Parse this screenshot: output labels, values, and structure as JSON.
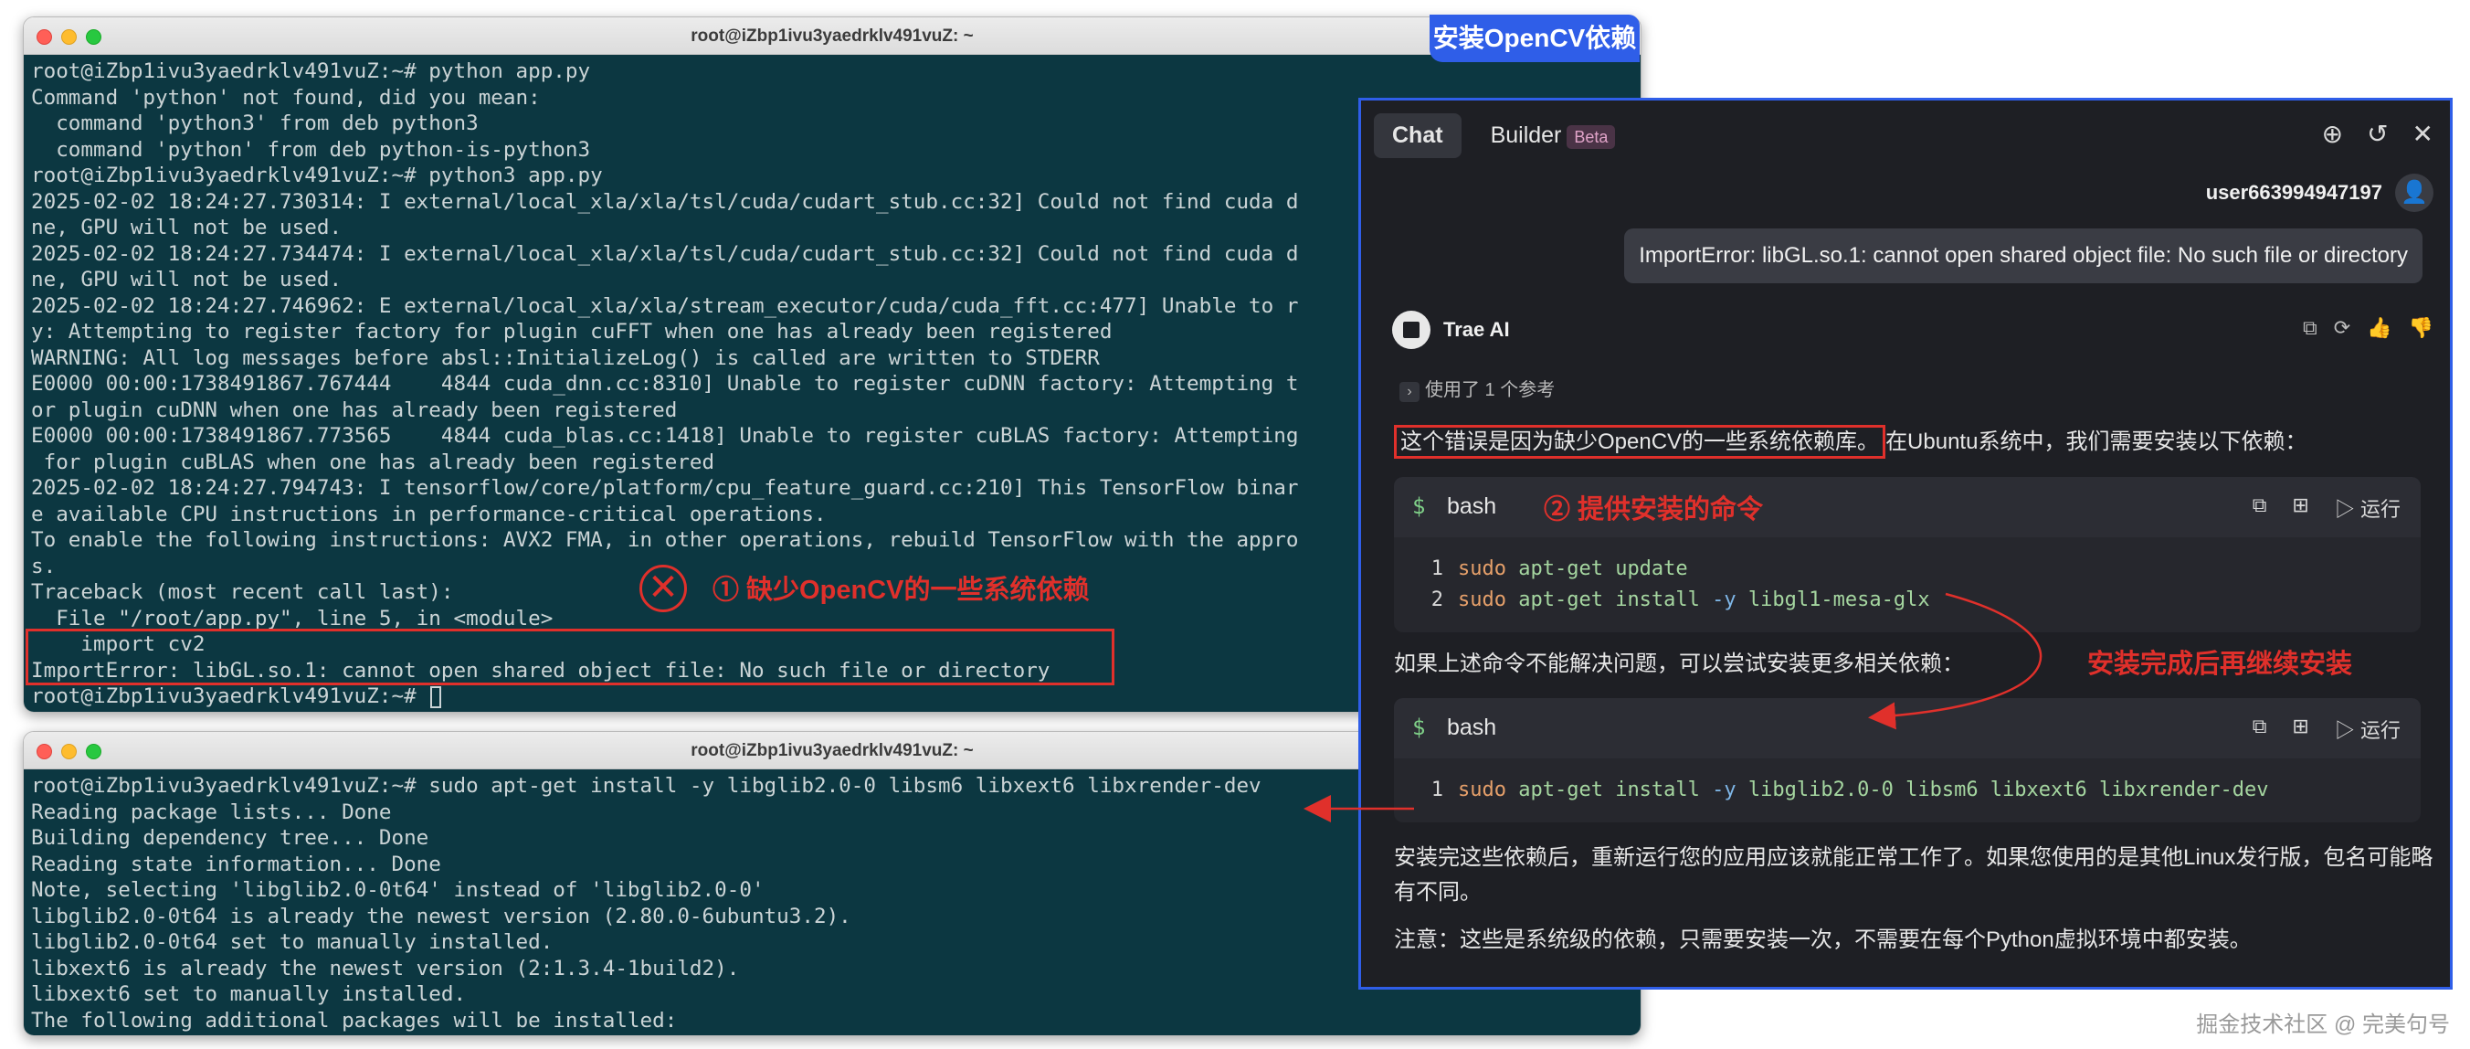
{
  "terminal1": {
    "title": "root@iZbp1ivu3yaedrklv491vuZ: ~",
    "lines": [
      "root@iZbp1ivu3yaedrklv491vuZ:~# python app.py",
      "Command 'python' not found, did you mean:",
      "  command 'python3' from deb python3",
      "  command 'python' from deb python-is-python3",
      "root@iZbp1ivu3yaedrklv491vuZ:~# python3 app.py",
      "2025-02-02 18:24:27.730314: I external/local_xla/xla/tsl/cuda/cudart_stub.cc:32] Could not find cuda d",
      "ne, GPU will not be used.",
      "2025-02-02 18:24:27.734474: I external/local_xla/xla/tsl/cuda/cudart_stub.cc:32] Could not find cuda d",
      "ne, GPU will not be used.",
      "2025-02-02 18:24:27.746962: E external/local_xla/xla/stream_executor/cuda/cuda_fft.cc:477] Unable to r",
      "y: Attempting to register factory for plugin cuFFT when one has already been registered",
      "WARNING: All log messages before absl::InitializeLog() is called are written to STDERR",
      "E0000 00:00:1738491867.767444    4844 cuda_dnn.cc:8310] Unable to register cuDNN factory: Attempting t",
      "or plugin cuDNN when one has already been registered",
      "E0000 00:00:1738491867.773565    4844 cuda_blas.cc:1418] Unable to register cuBLAS factory: Attempting",
      " for plugin cuBLAS when one has already been registered",
      "2025-02-02 18:24:27.794743: I tensorflow/core/platform/cpu_feature_guard.cc:210] This TensorFlow binar",
      "e available CPU instructions in performance-critical operations.",
      "To enable the following instructions: AVX2 FMA, in other operations, rebuild TensorFlow with the appro",
      "s.",
      "Traceback (most recent call last):",
      "  File \"/root/app.py\", line 5, in <module>",
      "    import cv2",
      "ImportError: libGL.so.1: cannot open shared object file: No such file or directory",
      "root@iZbp1ivu3yaedrklv491vuZ:~# "
    ]
  },
  "terminal2": {
    "title": "root@iZbp1ivu3yaedrklv491vuZ: ~",
    "lines": [
      "root@iZbp1ivu3yaedrklv491vuZ:~# sudo apt-get install -y libglib2.0-0 libsm6 libxext6 libxrender-dev",
      "Reading package lists... Done",
      "Building dependency tree... Done",
      "Reading state information... Done",
      "Note, selecting 'libglib2.0-0t64' instead of 'libglib2.0-0'",
      "libglib2.0-0t64 is already the newest version (2.80.0-6ubuntu3.2).",
      "libglib2.0-0t64 set to manually installed.",
      "libxext6 is already the newest version (2:1.3.4-1build2).",
      "libxext6 set to manually installed.",
      "The following additional packages will be installed:"
    ]
  },
  "annotations": {
    "install_opencv_tag": "安装OpenCV依赖",
    "missing_deps": "① 缺少OpenCV的一些系统依赖",
    "provided_cmd": "② 提供安装的命令",
    "continue_install": "安装完成后再继续安装"
  },
  "chat": {
    "tabs": [
      {
        "label": "Chat"
      },
      {
        "label": "Builder",
        "badge": "Beta"
      }
    ],
    "username": "user663994947197",
    "user_message": "ImportError: libGL.so.1: cannot open shared object file: No such file or directory",
    "ai_name": "Trae AI",
    "reference": "使用了 1 个参考",
    "para1_highlight": "这个错误是因为缺少OpenCV的一些系统依赖库。",
    "para1_rest": "在Ubuntu系统中，我们需要安装以下依赖：",
    "code1": {
      "lang": "bash",
      "run_label": "运行",
      "lines": [
        {
          "num": "1",
          "parts": [
            {
              "t": "sudo ",
              "c": "kw"
            },
            {
              "t": "apt-get update",
              "c": "cmd"
            }
          ]
        },
        {
          "num": "2",
          "parts": [
            {
              "t": "sudo ",
              "c": "kw"
            },
            {
              "t": "apt-get install ",
              "c": "cmd"
            },
            {
              "t": "-y ",
              "c": "flag"
            },
            {
              "t": "libgl1-mesa-glx",
              "c": "pk"
            }
          ]
        }
      ]
    },
    "para2": "如果上述命令不能解决问题，可以尝试安装更多相关依赖：",
    "code2": {
      "lang": "bash",
      "run_label": "运行",
      "lines": [
        {
          "num": "1",
          "parts": [
            {
              "t": "sudo ",
              "c": "kw"
            },
            {
              "t": "apt-get install ",
              "c": "cmd"
            },
            {
              "t": "-y ",
              "c": "flag"
            },
            {
              "t": "libglib2.0-0 libsm6 libxext6 libxrender-dev",
              "c": "pk"
            }
          ]
        }
      ]
    },
    "para3_line1": "安装完这些依赖后，重新运行您的应用应该就能正常工作了。如果您使用的是其他Linux发行版，包名可能略",
    "para3_line2": "有不同。",
    "para4": "注意：这些是系统级的依赖，只需要安装一次，不需要在每个Python虚拟环境中都安装。"
  },
  "watermark": "掘金技术社区 @ 完美句号",
  "colors": {
    "terminal_bg": "#0c3741",
    "annotation_red": "#e0302b",
    "accent_blue": "#2f5ee8",
    "chat_bg": "#1e1f24"
  }
}
